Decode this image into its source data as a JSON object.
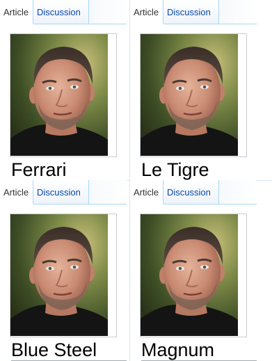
{
  "panels": [
    {
      "tabs": {
        "article": "Article",
        "discussion": "Discussion"
      },
      "caption": "Ferrari"
    },
    {
      "tabs": {
        "article": "Article",
        "discussion": "Discussion"
      },
      "caption": "Le Tigre"
    },
    {
      "tabs": {
        "article": "Article",
        "discussion": "Discussion"
      },
      "caption": "Blue Steel"
    },
    {
      "tabs": {
        "article": "Article",
        "discussion": "Discussion"
      },
      "caption": "Magnum"
    }
  ],
  "colors": {
    "tab_border": "#a7d7f9",
    "link": "#0645ad",
    "text": "#000000"
  }
}
